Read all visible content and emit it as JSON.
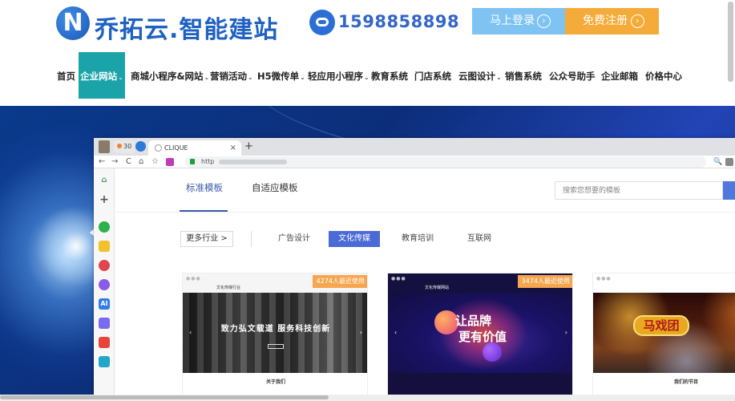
{
  "brand": {
    "logo_letter": "N",
    "name": "乔拓云.智能建站",
    "phone": "1598858898",
    "accent": "#1f61c1"
  },
  "actions": {
    "login_label": "马上登录",
    "register_label": "免费注册",
    "arrow_glyph": "›"
  },
  "nav": {
    "items": [
      {
        "label": "首页",
        "caret": ""
      },
      {
        "label": "企业网站",
        "caret": "⌄"
      },
      {
        "label": "商城小程序&网站",
        "caret": "⌄"
      },
      {
        "label": "营销活动",
        "caret": "⌄"
      },
      {
        "label": "H5微传单",
        "caret": "⌄"
      },
      {
        "label": "轻应用小程序",
        "caret": "⌄"
      },
      {
        "label": "教育系统",
        "caret": ""
      },
      {
        "label": "门店系统",
        "caret": ""
      },
      {
        "label": "云图设计",
        "caret": "⌄"
      },
      {
        "label": "销售系统",
        "caret": ""
      },
      {
        "label": "公众号助手",
        "caret": ""
      },
      {
        "label": "企业邮箱",
        "caret": ""
      },
      {
        "label": "价格中心",
        "caret": ""
      }
    ],
    "active_color": "#1ba3aa"
  },
  "browser": {
    "badge_count": "30",
    "tab_title": "CLIQUE",
    "tab_close": "×",
    "new_tab": "+",
    "url_prefix": "http",
    "toolbar_icons": [
      "back-icon",
      "forward-icon",
      "reload-icon",
      "home-icon",
      "bookmark-icon",
      "extension-icon"
    ],
    "glyphs": {
      "back": "←",
      "forward": "→",
      "reload": "C",
      "home": "⌂",
      "bookmark": "☆",
      "zoom": "🔍"
    }
  },
  "sidebar_glyphs": {
    "home": "⌂",
    "add": "+",
    "ai": "AI"
  },
  "content": {
    "tabs": [
      "标准模板",
      "自适应模板"
    ],
    "search_placeholder": "搜索您想要的模板",
    "more_label": "更多行业 >",
    "filters": [
      "广告设计",
      "文化传媒",
      "教育培训",
      "互联网"
    ],
    "active_filter_color": "#4a6ad6"
  },
  "cards": [
    {
      "badge": "4274人最近使用",
      "head_label": "文化传媒行业",
      "headline": "致力弘文载道  服务科技创新",
      "foot": "关于我们"
    },
    {
      "badge": "3474人最近使用",
      "head_label": "文化传媒网站",
      "headline1": "让品牌",
      "headline2": "更有价值",
      "foot": ""
    },
    {
      "badge": "",
      "head_label": "",
      "headline": "马戏团",
      "foot": "我们的节目"
    }
  ]
}
